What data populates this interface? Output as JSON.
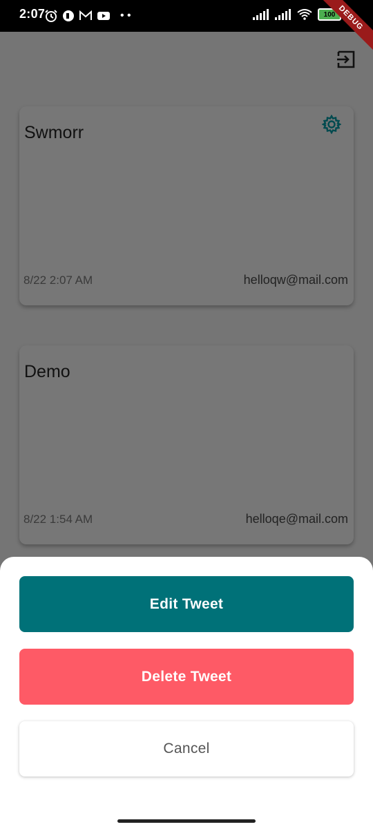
{
  "status_bar": {
    "time": "2:07",
    "battery": "100",
    "debug_label": "DEBUG"
  },
  "app_bar": {
    "logout_icon": "logout-icon"
  },
  "tweets": [
    {
      "title": "Swmorr",
      "date": "8/22 2:07 AM",
      "email": "helloqw@mail.com",
      "has_settings": true
    },
    {
      "title": "Demo",
      "date": "8/22 1:54 AM",
      "email": "helloqe@mail.com",
      "has_settings": false
    }
  ],
  "bottom_sheet": {
    "edit_label": "Edit Tweet",
    "delete_label": "Delete Tweet",
    "cancel_label": "Cancel"
  },
  "colors": {
    "accent": "#007178",
    "danger": "#fe5a66",
    "scrim": "#757575"
  }
}
